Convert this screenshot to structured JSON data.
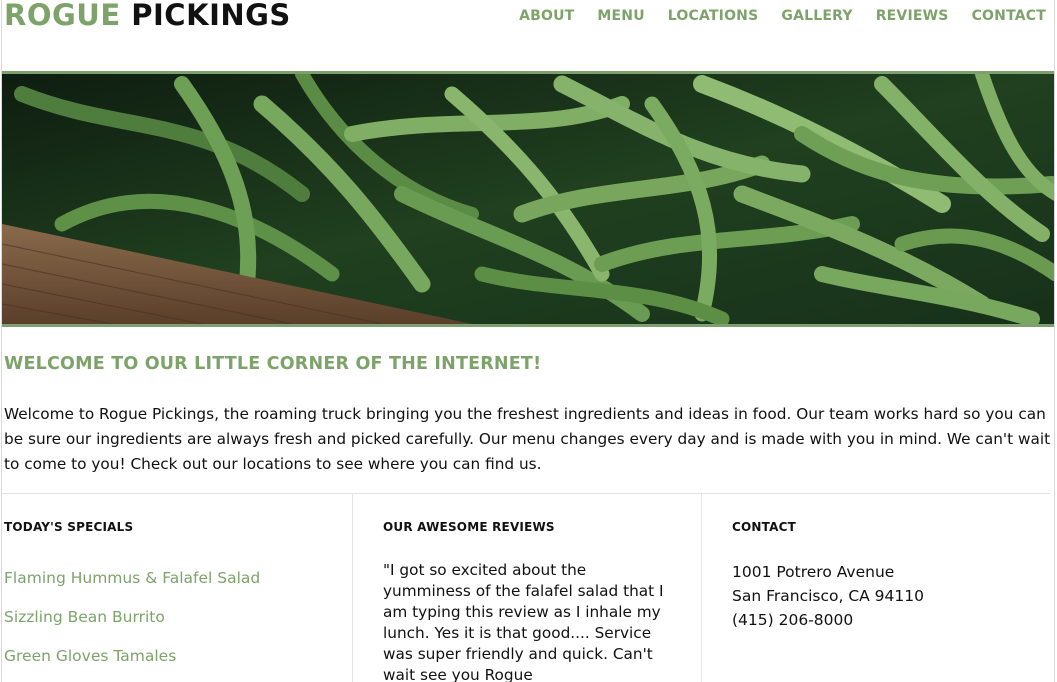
{
  "brand": {
    "part1": "ROGUE",
    "part2": "PICKINGS"
  },
  "nav": {
    "items": [
      "ABOUT",
      "MENU",
      "LOCATIONS",
      "GALLERY",
      "REVIEWS",
      "CONTACT"
    ]
  },
  "hero": {
    "image": "green-beans-photo"
  },
  "welcome": {
    "title": "WELCOME TO OUR LITTLE CORNER OF THE INTERNET!",
    "body": "Welcome to Rogue Pickings, the roaming truck bringing you the freshest ingredients and ideas in food. Our team works hard so you can be sure our ingredients are always fresh and picked carefully. Our menu changes every day and is made with you in mind. We can't wait to come to you! Check out our locations to see where you can find us."
  },
  "specials": {
    "title": "TODAY'S SPECIALS",
    "items": [
      "Flaming Hummus & Falafel Salad",
      "Sizzling Bean Burrito",
      "Green Gloves Tamales"
    ]
  },
  "reviews": {
    "title": "OUR AWESOME REVIEWS",
    "text": "\"I got so excited about the yumminess of the falafel salad that I am typing this review as I inhale my lunch. Yes it is that good.... Service was super friendly and quick. Can't wait see you Rogue"
  },
  "contact": {
    "title": "CONTACT",
    "address1": "1001 Potrero Avenue",
    "address2": "San Francisco, CA 94110",
    "phone": "(415) 206-8000"
  },
  "colors": {
    "accent": "#7da36a",
    "text": "#111111",
    "border": "#7ea06e"
  }
}
